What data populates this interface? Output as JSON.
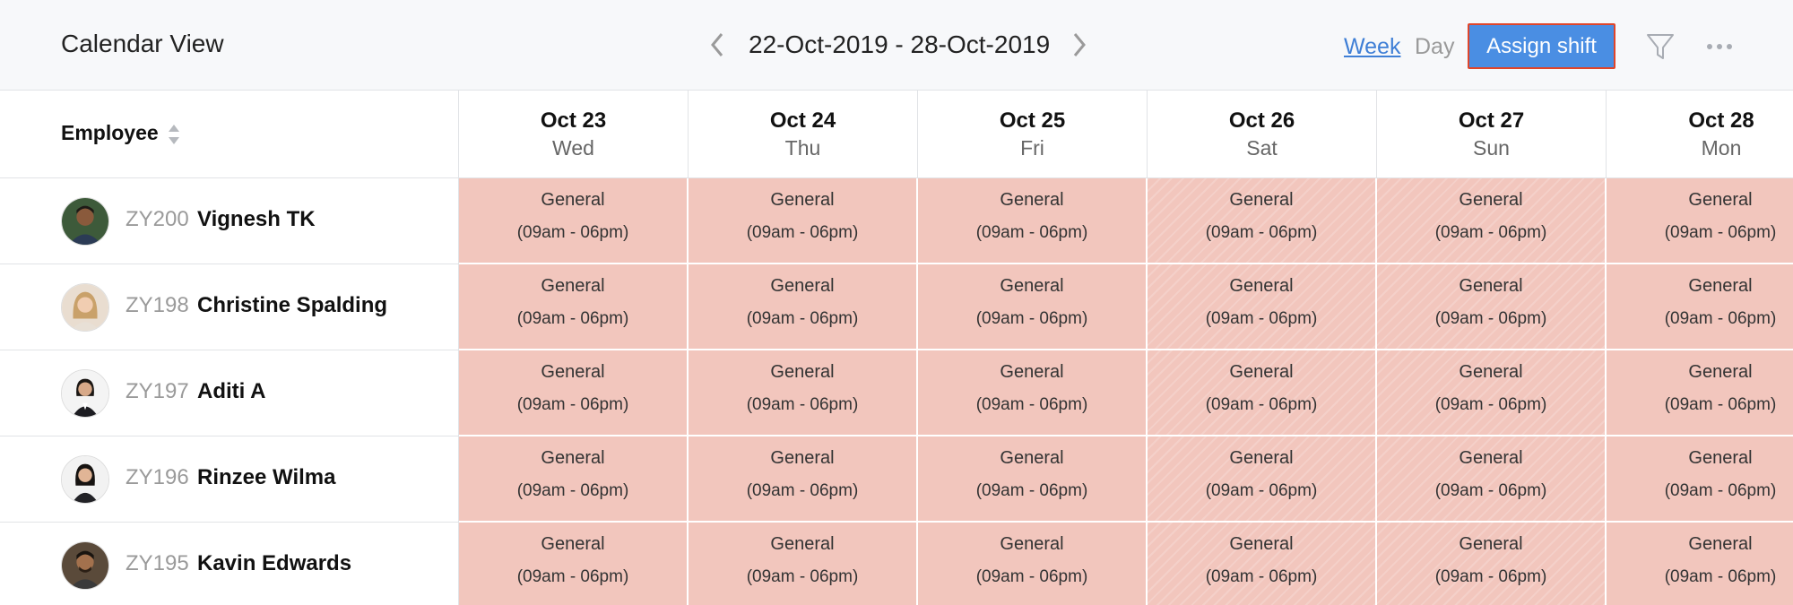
{
  "header": {
    "title": "Calendar View",
    "date_range": "22-Oct-2019 - 28-Oct-2019",
    "view_week": "Week",
    "view_day": "Day",
    "assign_shift": "Assign shift",
    "icons": [
      "chevron-left-icon",
      "chevron-right-icon",
      "filter-icon",
      "more-icon"
    ],
    "accent_color": "#4a8ee3"
  },
  "table": {
    "employee_header": "Employee",
    "days": [
      {
        "date": "Oct 23",
        "day": "Wed"
      },
      {
        "date": "Oct 24",
        "day": "Thu"
      },
      {
        "date": "Oct 25",
        "day": "Fri"
      },
      {
        "date": "Oct 26",
        "day": "Sat"
      },
      {
        "date": "Oct 27",
        "day": "Sun"
      },
      {
        "date": "Oct 28",
        "day": "Mon"
      }
    ],
    "shift_color": "#f2c6bd",
    "rows": [
      {
        "id": "ZY200",
        "name": "Vignesh TK",
        "shifts": [
          {
            "name": "General",
            "time": "(09am - 06pm)"
          },
          {
            "name": "General",
            "time": "(09am - 06pm)"
          },
          {
            "name": "General",
            "time": "(09am - 06pm)"
          },
          {
            "name": "General",
            "time": "(09am - 06pm)"
          },
          {
            "name": "General",
            "time": "(09am - 06pm)"
          },
          {
            "name": "General",
            "time": "(09am - 06pm)"
          }
        ]
      },
      {
        "id": "ZY198",
        "name": "Christine Spalding",
        "shifts": [
          {
            "name": "General",
            "time": "(09am - 06pm)"
          },
          {
            "name": "General",
            "time": "(09am - 06pm)"
          },
          {
            "name": "General",
            "time": "(09am - 06pm)"
          },
          {
            "name": "General",
            "time": "(09am - 06pm)"
          },
          {
            "name": "General",
            "time": "(09am - 06pm)"
          },
          {
            "name": "General",
            "time": "(09am - 06pm)"
          }
        ]
      },
      {
        "id": "ZY197",
        "name": "Aditi A",
        "shifts": [
          {
            "name": "General",
            "time": "(09am - 06pm)"
          },
          {
            "name": "General",
            "time": "(09am - 06pm)"
          },
          {
            "name": "General",
            "time": "(09am - 06pm)"
          },
          {
            "name": "General",
            "time": "(09am - 06pm)"
          },
          {
            "name": "General",
            "time": "(09am - 06pm)"
          },
          {
            "name": "General",
            "time": "(09am - 06pm)"
          }
        ]
      },
      {
        "id": "ZY196",
        "name": "Rinzee Wilma",
        "shifts": [
          {
            "name": "General",
            "time": "(09am - 06pm)"
          },
          {
            "name": "General",
            "time": "(09am - 06pm)"
          },
          {
            "name": "General",
            "time": "(09am - 06pm)"
          },
          {
            "name": "General",
            "time": "(09am - 06pm)"
          },
          {
            "name": "General",
            "time": "(09am - 06pm)"
          },
          {
            "name": "General",
            "time": "(09am - 06pm)"
          }
        ]
      },
      {
        "id": "ZY195",
        "name": "Kavin Edwards",
        "shifts": [
          {
            "name": "General",
            "time": "(09am - 06pm)"
          },
          {
            "name": "General",
            "time": "(09am - 06pm)"
          },
          {
            "name": "General",
            "time": "(09am - 06pm)"
          },
          {
            "name": "General",
            "time": "(09am - 06pm)"
          },
          {
            "name": "General",
            "time": "(09am - 06pm)"
          },
          {
            "name": "General",
            "time": "(09am - 06pm)"
          }
        ]
      }
    ]
  }
}
